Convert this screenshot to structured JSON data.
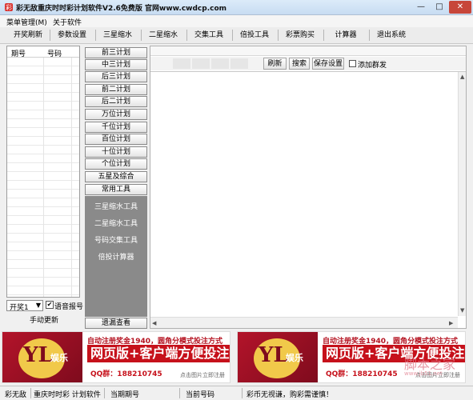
{
  "window": {
    "title": "彩无敌重庆时时彩计划软件V2.6免费版    官网www.cwdcp.com",
    "buttons": {
      "minimize": "—",
      "maximize": "□",
      "close": "✕"
    }
  },
  "menu": {
    "items": [
      "菜单管理(M)",
      "关于软件"
    ]
  },
  "toolbar": {
    "items": [
      "开奖刷新",
      "参数设置",
      "三星缩水",
      "二星缩水",
      "交集工具",
      "倍投工具",
      "彩票购买",
      "计算器",
      "退出系统"
    ]
  },
  "left_panel": {
    "columns": [
      "期号",
      "号码"
    ],
    "select": {
      "value": "开奖1"
    },
    "voice_checked": true,
    "voice_label": "语音报号",
    "manual_button": "手动更新"
  },
  "plans": {
    "items": [
      "前三计划",
      "中三计划",
      "后三计划",
      "前二计划",
      "后二计划",
      "万位计划",
      "千位计划",
      "百位计划",
      "十位计划",
      "个位计划",
      "五星及综合",
      "常用工具"
    ],
    "tools": [
      "三星缩水工具",
      "二星缩水工具",
      "号码交集工具",
      "倍投计算器"
    ],
    "missing_button": "遗漏查看"
  },
  "right_panel": {
    "refresh": "刷新",
    "search": "搜索",
    "save": "保存设置",
    "add_group_label": "添加群发",
    "add_group_checked": false
  },
  "banner": {
    "logo_mark": "YL",
    "logo_text": "娱乐",
    "line1": "自动注册奖金1940，圆角分模式投注方式",
    "line2": "网页版+客户端方便投注",
    "qq": "QQ群：188210745",
    "cta": "点击图片立即注册"
  },
  "watermark": {
    "main": "脚本之家",
    "sub": "www.jb51.net"
  },
  "status": [
    "彩无敌",
    "重庆时时彩 计划软件",
    "当期期号",
    "当前号码",
    "彩币无视谦，购彩需谨慎！"
  ]
}
